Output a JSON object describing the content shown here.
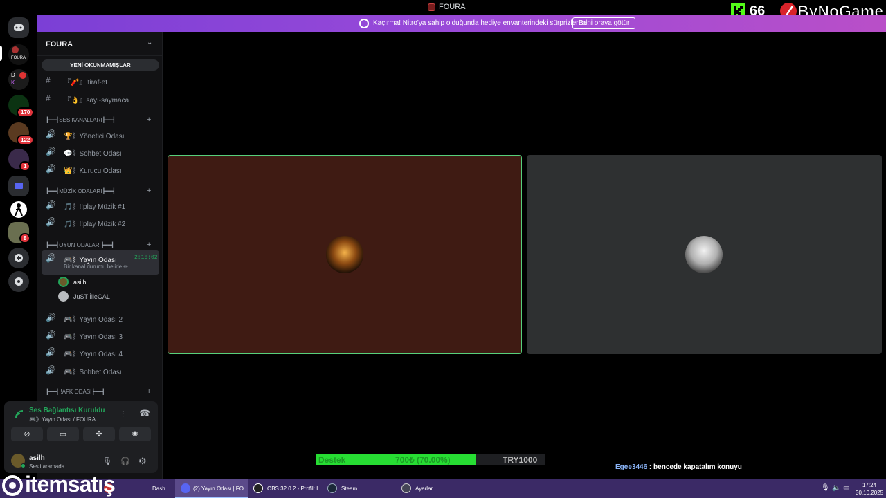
{
  "window": {
    "title": "FOURA"
  },
  "banner": {
    "text": "Kaçırma! Nitro'ya sahip olduğunda hediye envanterindeki sürprizleri al.",
    "button": "Beni oraya götür",
    "close": "✕"
  },
  "overlay": {
    "kick_count": "66",
    "brand": "ByNoGame",
    "watermark": "itemsatış"
  },
  "rail": {
    "servers": [
      {
        "name": "discord-home-icon"
      },
      {
        "label": "FOURA",
        "badge": ""
      },
      {
        "label": "",
        "badge": ""
      },
      {
        "label": "",
        "badge": "170"
      },
      {
        "label": "",
        "badge": "122"
      },
      {
        "label": "",
        "badge": "1"
      },
      {
        "label": "",
        "badge": ""
      },
      {
        "label": "",
        "badge": ""
      },
      {
        "label": "",
        "badge": "8"
      }
    ]
  },
  "sidebar": {
    "server_name": "FOURA",
    "unread": "YENİ OKUNMAMIŞLAR",
    "text_channels": [
      {
        "name": "『🧨』itiraf-et"
      },
      {
        "name": "『👌』sayı-saymaca"
      }
    ],
    "categories": [
      {
        "name": "┣━━┫SES KANALLARI┣━━┫"
      },
      {
        "name": "┣━━┫MÜZİK ODALARI┣━━┫"
      },
      {
        "name": "┣━━┫OYUN ODALARI┣━━┫"
      },
      {
        "name": "┣━━┫!!AFK ODASI┣━━┫"
      }
    ],
    "voice_channels_1": [
      {
        "name": "🏆》Yönetici Odası"
      },
      {
        "name": "💬》Sohbet Odası"
      },
      {
        "name": "👑》Kurucu Odası"
      }
    ],
    "music_channels": [
      {
        "name": "🎵》!!play Müzik #1"
      },
      {
        "name": "🎵》!!play Müzik #2"
      }
    ],
    "game_channels": [
      {
        "name": "🎮》Yayın Odası",
        "timer": "2:16:02",
        "status": "Bir kanal durumu belirle ✏"
      },
      {
        "name": "🎮》Yayın Odası 2"
      },
      {
        "name": "🎮》Yayın Odası 3"
      },
      {
        "name": "🎮》Yayın Odası 4"
      },
      {
        "name": "🎮》Sohbet Odası"
      }
    ],
    "members": [
      {
        "name": "asilh"
      },
      {
        "name": "JuST İlleGAL"
      }
    ]
  },
  "voice_panel": {
    "connected": "Ses Bağlantısı Kuruldu",
    "location": "🎮》Yayın Odası / FOURA",
    "user": "asilh",
    "user_status": "Sesli aramada"
  },
  "stream_overlay": {
    "support_label": "Destek",
    "support_amount": "700₺ (70.00%)",
    "support_progress": 0.7,
    "support_goal": "TRY1000",
    "chat_user": "Egee3446",
    "chat_message": " : bencede kapatalım konuyu"
  },
  "taskbar": {
    "items": [
      {
        "label": "(2) Yayın Odası | FO..."
      },
      {
        "label": "OBS 32.0.2 - Profil: İ..."
      },
      {
        "label": "Steam"
      },
      {
        "label": "Ayarlar"
      }
    ],
    "partial": "Dash...",
    "time": "17:24",
    "date": "30.10.2025"
  },
  "colors": {
    "accent_green": "#23a55a",
    "nitro_purple": "#9a4ad8",
    "unread_red": "#e0343c"
  }
}
